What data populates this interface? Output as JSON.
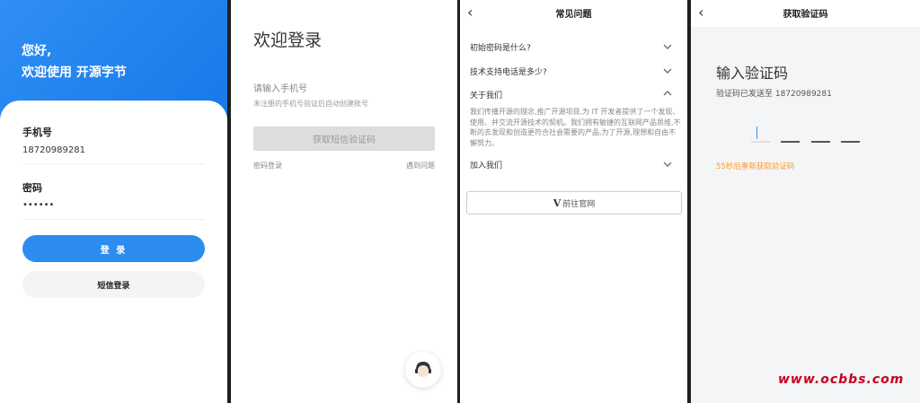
{
  "login": {
    "greeting_line1": "您好,",
    "greeting_line2": "欢迎使用 开源字节",
    "phone_label": "手机号",
    "phone_value": "18720989281",
    "password_label": "密码",
    "password_value": "••••••",
    "login_button": "登 录",
    "sms_login_button": "短信登录",
    "brand_color": "#2d8cf0"
  },
  "welcome": {
    "title": "欢迎登录",
    "phone_placeholder": "请输入手机号",
    "hint": "未注册的手机号验证后自动创建账号",
    "get_code_button": "获取短信验证码",
    "password_login_link": "密码登录",
    "trouble_link": "遇到问题"
  },
  "faq": {
    "title": "常见问题",
    "items": [
      {
        "q": "初始密码是什么?"
      },
      {
        "q": "技术支持电话是多少?"
      },
      {
        "q": "关于我们",
        "a": "我们传播开源的理念,推广开源项目,为 IT 开发者提供了一个发现、使用、并交流开源技术的契机。我们拥有敏捷的互联网产品思维,不断的去发现和创造更符合社会需要的产品,为了开源,理想和自由不懈努力。"
      },
      {
        "q": "加入我们"
      }
    ],
    "website_button": "前往官网",
    "website_logo": "V"
  },
  "verify": {
    "nav_title": "获取验证码",
    "title": "输入验证码",
    "sent_to": "验证码已发送至 18720989281",
    "countdown": "55秒后重新获取验证码",
    "countdown_color": "#ff9a2e"
  },
  "watermark": "www.ocbbs.com"
}
